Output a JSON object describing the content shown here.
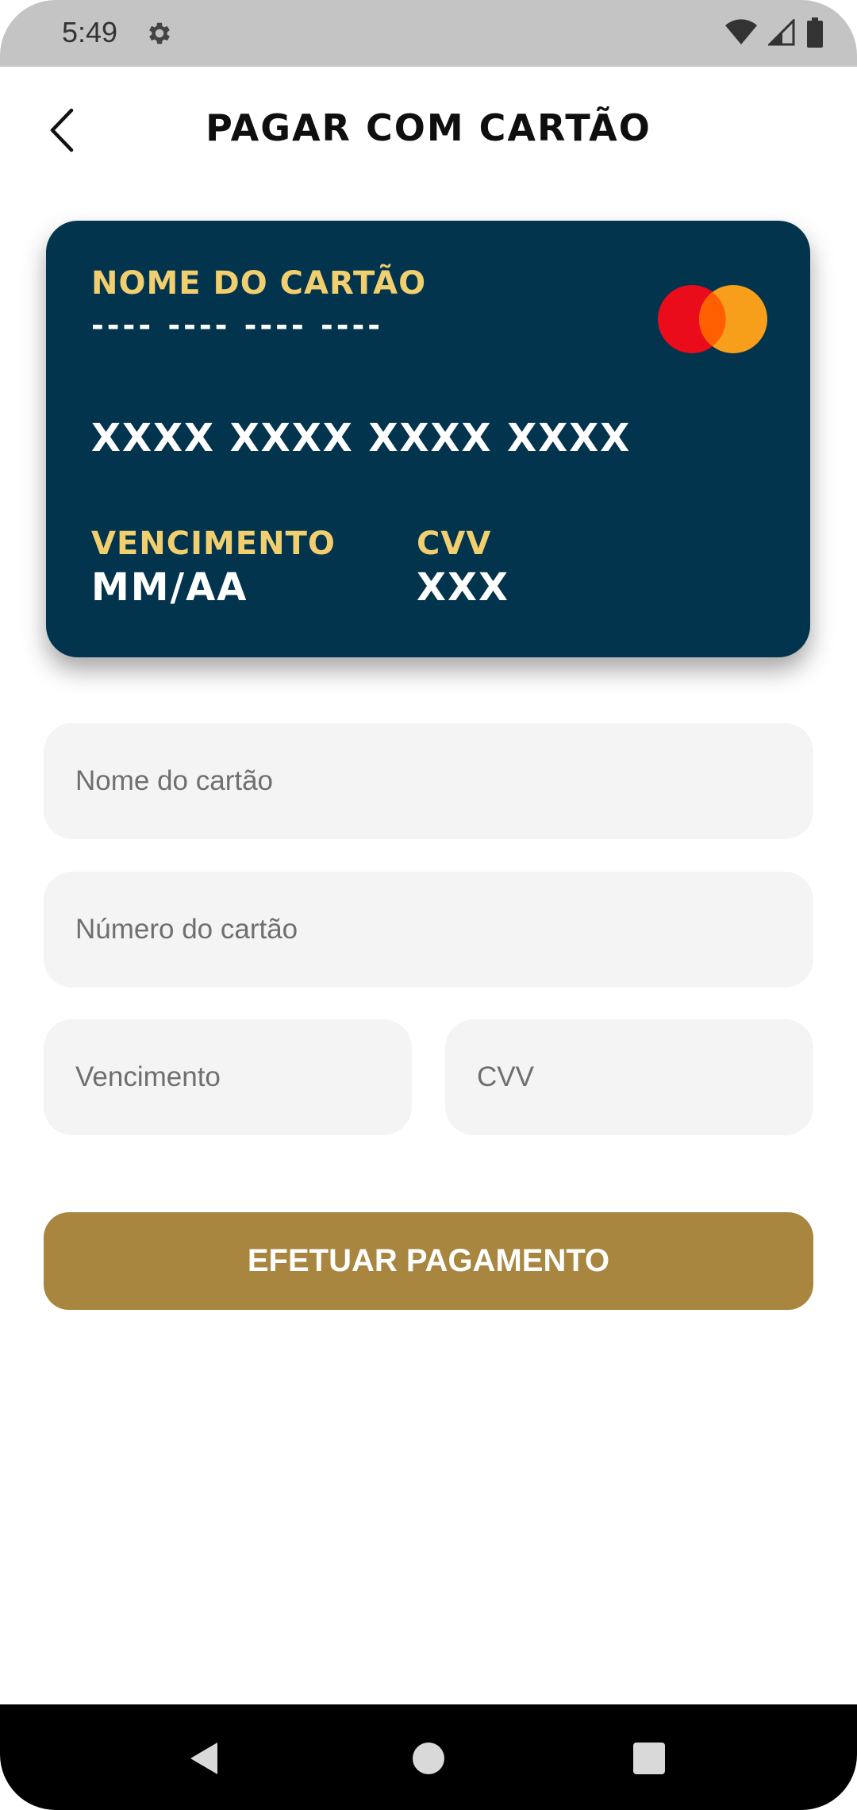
{
  "status_bar": {
    "time": "5:49",
    "icons": [
      "gear-icon",
      "wifi-icon",
      "signal-icon",
      "battery-icon"
    ]
  },
  "header": {
    "title": "PAGAR COM CARTÃO",
    "back_icon": "chevron-left-icon"
  },
  "card_preview": {
    "name_label": "NOME DO CARTÃO",
    "name_value": "---- ---- ---- ----",
    "number": "XXXX XXXX XXXX XXXX",
    "expiry_label": "VENCIMENTO",
    "expiry_value": "MM/AA",
    "cvv_label": "CVV",
    "cvv_value": "XXX",
    "brand_icon": "mastercard-logo",
    "background_color": "#03344d",
    "label_color": "#f2cf6e"
  },
  "form": {
    "name_placeholder": "Nome do cartão",
    "number_placeholder": "Número do cartão",
    "expiry_placeholder": "Vencimento",
    "cvv_placeholder": "CVV"
  },
  "pay_button": {
    "label": "EFETUAR PAGAMENTO",
    "color": "#a88640"
  },
  "nav_bar": {
    "icons": [
      "back-triangle-icon",
      "home-circle-icon",
      "recents-square-icon"
    ]
  }
}
